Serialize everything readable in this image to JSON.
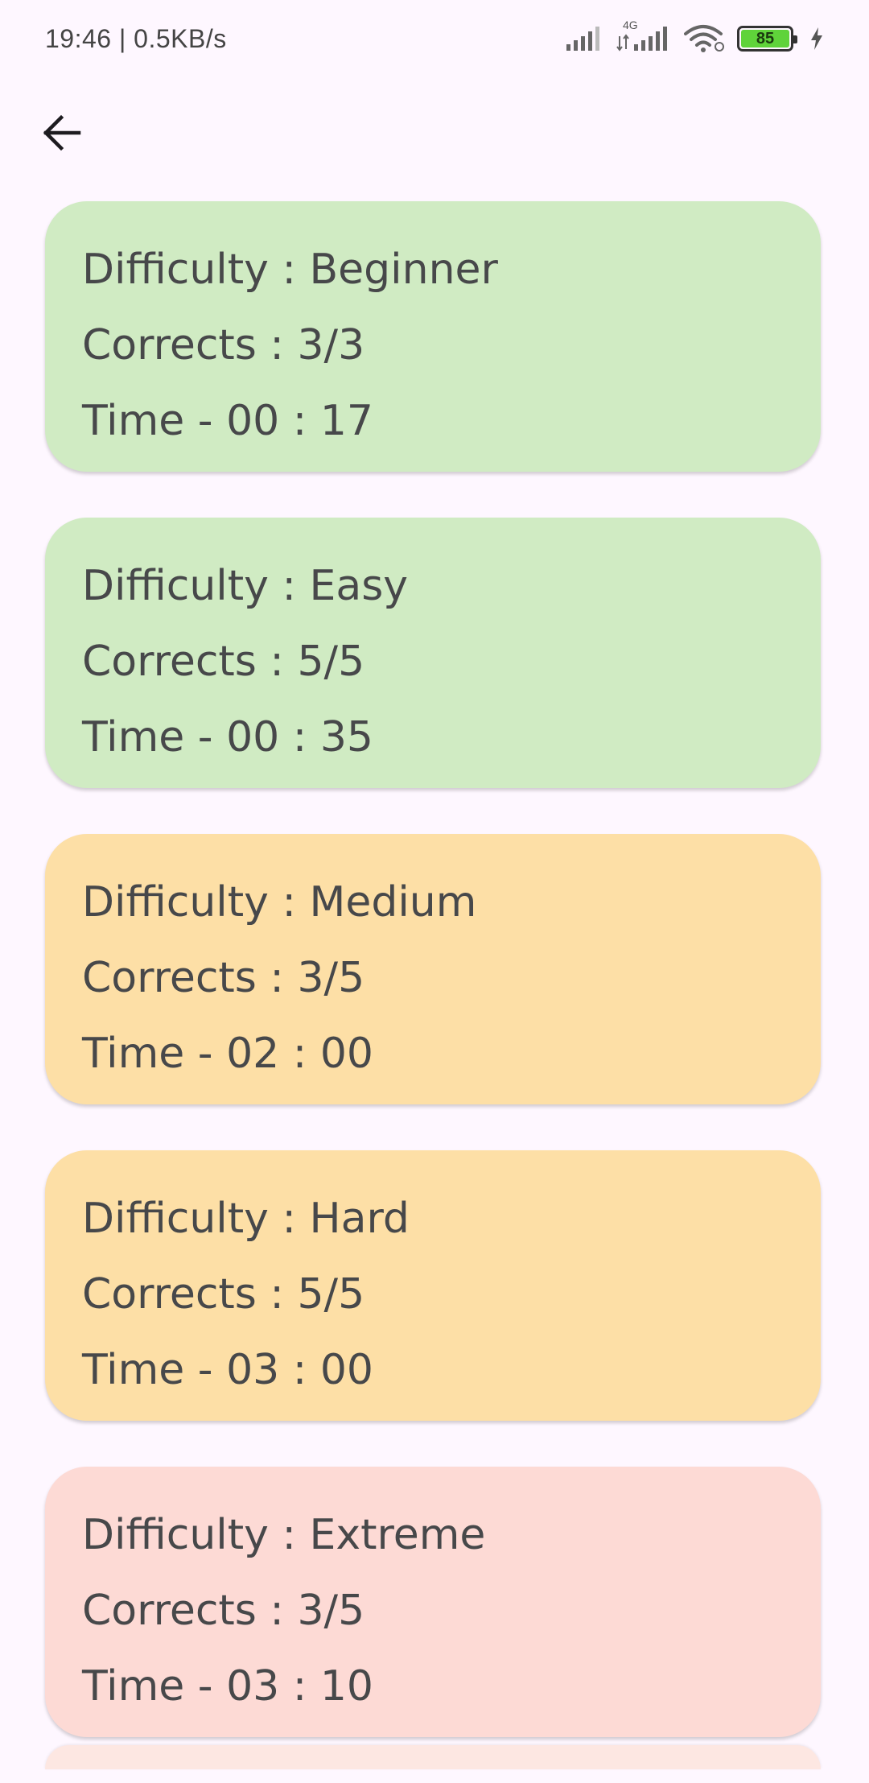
{
  "status_bar": {
    "time_speed": "19:46 | 0.5KB/s",
    "network_label": "4G",
    "battery_level": "85",
    "battery_color": "#5FD33A"
  },
  "app_bar": {
    "back_icon": "arrow-left-icon"
  },
  "results": [
    {
      "difficulty": "Difficulty : Beginner",
      "corrects": "Corrects : 3/3",
      "time": "Time - 00 : 17",
      "color": "#D0EBC3"
    },
    {
      "difficulty": "Difficulty : Easy",
      "corrects": "Corrects : 5/5",
      "time": "Time - 00 : 35",
      "color": "#D0EBC3"
    },
    {
      "difficulty": "Difficulty : Medium",
      "corrects": "Corrects : 3/5",
      "time": "Time - 02 : 00",
      "color": "#FDDFA6"
    },
    {
      "difficulty": "Difficulty : Hard",
      "corrects": "Corrects : 5/5",
      "time": "Time - 03 : 00",
      "color": "#FDDFA6"
    },
    {
      "difficulty": "Difficulty : Extreme",
      "corrects": "Corrects : 3/5",
      "time": "Time - 03 : 10",
      "color": "#FDDAD5"
    }
  ],
  "next_card_color": "#FDE7E2"
}
